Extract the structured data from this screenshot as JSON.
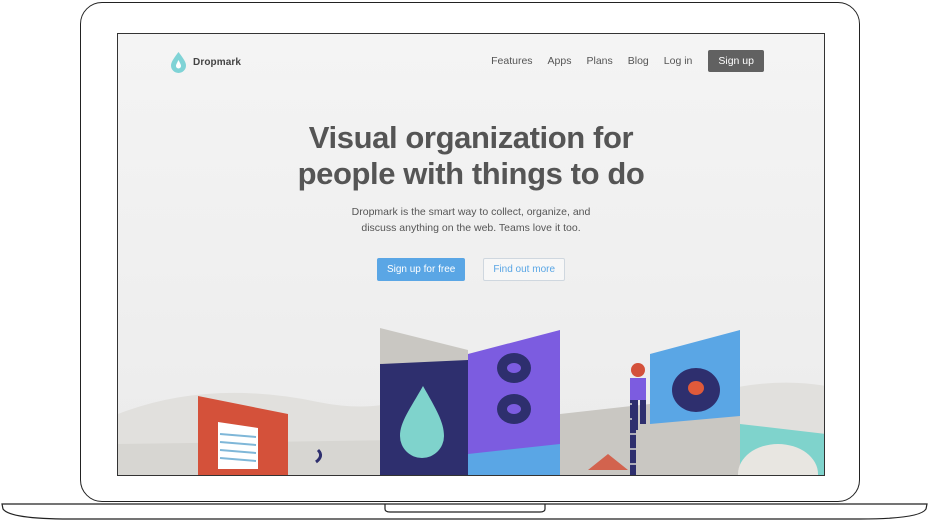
{
  "brand": {
    "name": "Dropmark",
    "accent": "#5aa6e5",
    "logo_color": "#7fd3d6"
  },
  "nav": {
    "links": [
      "Features",
      "Apps",
      "Plans",
      "Blog",
      "Log in"
    ],
    "signup_label": "Sign up"
  },
  "hero": {
    "title_line1": "Visual organization for",
    "title_line2": "people with things to do",
    "subtitle_line1": "Dropmark is the smart way to collect, organize, and",
    "subtitle_line2": "discuss anything on the web. Teams love it too.",
    "primary_cta": "Sign up for free",
    "secondary_cta": "Find out more"
  }
}
